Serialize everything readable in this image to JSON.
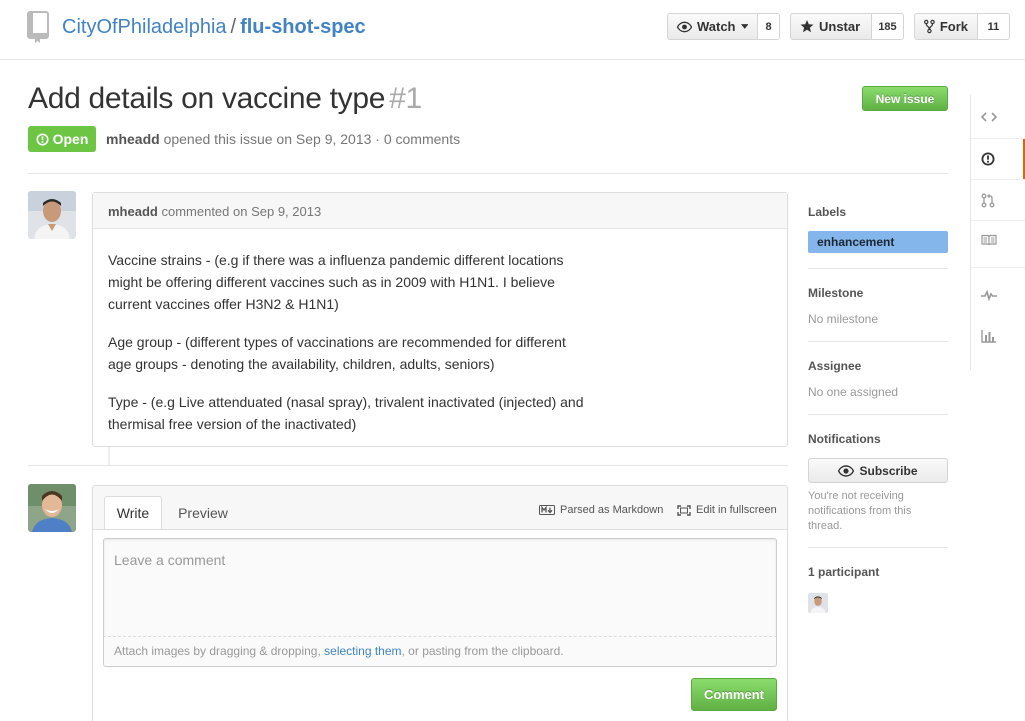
{
  "repo": {
    "owner": "CityOfPhiladelphia",
    "separator": "/",
    "name": "flu-shot-spec"
  },
  "actions": {
    "watch_label": "Watch",
    "watch_count": "8",
    "star_label": "Unstar",
    "star_count": "185",
    "fork_label": "Fork",
    "fork_count": "11"
  },
  "issue": {
    "title": "Add details on vaccine type",
    "number": "#1",
    "state": "Open",
    "author": "mheadd",
    "meta_text": "opened this issue on Sep 9, 2013 · 0 comments",
    "new_issue_label": "New issue"
  },
  "comment": {
    "author": "mheadd",
    "meta": "commented on Sep 9, 2013",
    "paragraphs": [
      "Vaccine strains - (e.g if there was a influenza pandemic different locations might be offering different vaccines such as in 2009 with H1N1. I believe current vaccines offer H3N2 & H1N1)",
      "Age group - (different types of vaccinations are recommended for different age groups - denoting the availability, children, adults, seniors)",
      "Type - (e.g Live attenduated (nasal spray), trivalent inactivated (injected) and thermisal free version of the inactivated)"
    ]
  },
  "composer": {
    "tab_write": "Write",
    "tab_preview": "Preview",
    "markdown_label": "Parsed as Markdown",
    "fullscreen_label": "Edit in fullscreen",
    "placeholder": "Leave a comment",
    "hint_before": "Attach images by dragging & dropping, ",
    "hint_link": "selecting them",
    "hint_after": ", or pasting from the clipboard.",
    "submit_label": "Comment"
  },
  "sidebar": {
    "labels_heading": "Labels",
    "label_name": "enhancement",
    "label_color": "#84b6eb",
    "milestone_heading": "Milestone",
    "milestone_value": "No milestone",
    "assignee_heading": "Assignee",
    "assignee_value": "No one assigned",
    "notifications_heading": "Notifications",
    "subscribe_label": "Subscribe",
    "notifications_reason": "You're not receiving notifications from this thread.",
    "participants_heading": "1 participant"
  },
  "sidenav_icons": [
    "code-icon",
    "issues-icon",
    "pull-request-icon",
    "wiki-icon",
    "pulse-icon",
    "graphs-icon"
  ],
  "colors": {
    "link": "#4183c4",
    "open_green": "#6cc644",
    "selected_tab_accent": "#d26911"
  }
}
